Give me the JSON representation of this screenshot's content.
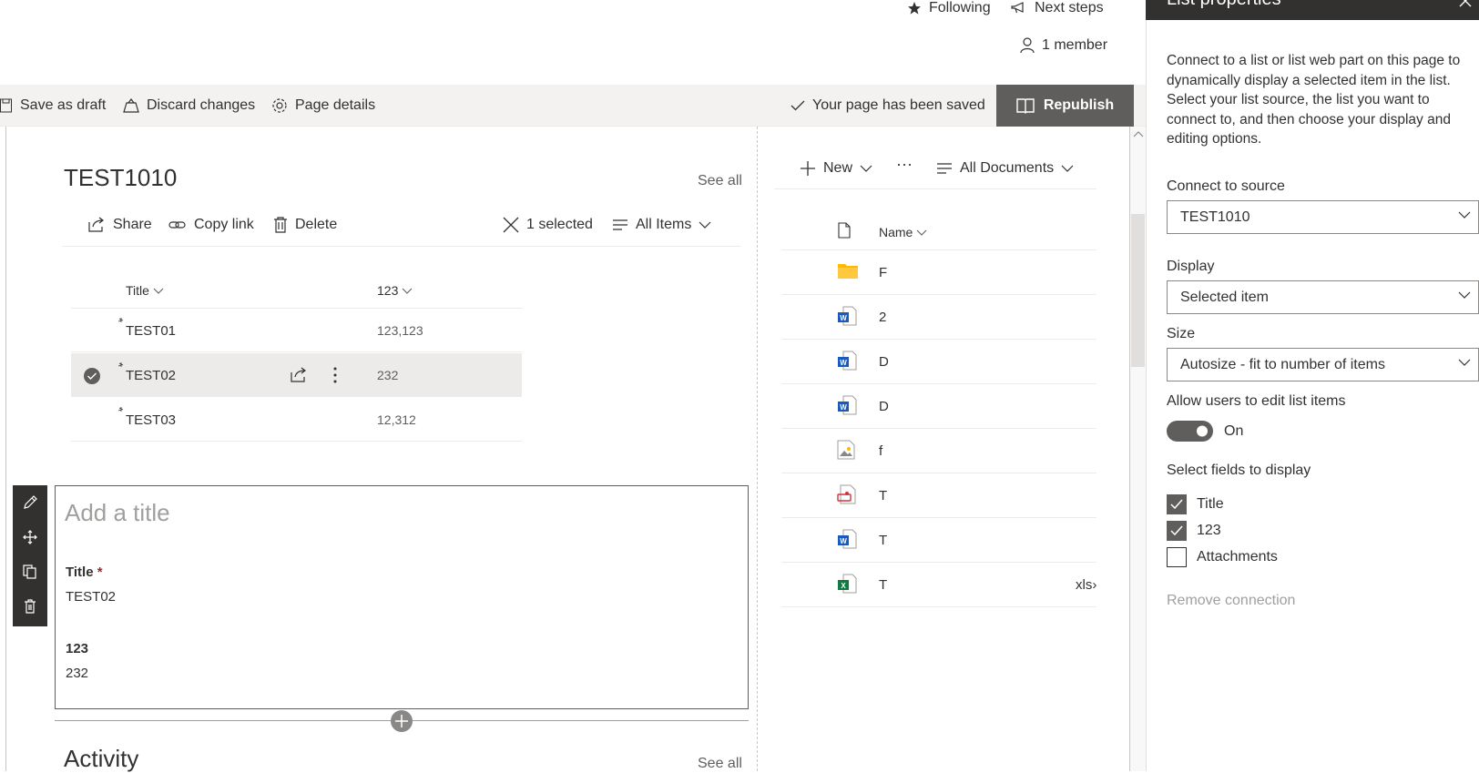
{
  "header": {
    "following_label": "Following",
    "next_steps_label": "Next steps",
    "members_label": "1 member"
  },
  "command_bar": {
    "save_draft_label": "Save as draft",
    "discard_label": "Discard changes",
    "page_details_label": "Page details",
    "saved_status": "Your page has been saved",
    "republish_label": "Republish"
  },
  "list_webpart": {
    "title": "TEST1010",
    "see_all": "See all",
    "share_label": "Share",
    "copy_link_label": "Copy link",
    "delete_label": "Delete",
    "selected_count": "1 selected",
    "view_label": "All Items",
    "columns": [
      "Title",
      "123"
    ],
    "rows": [
      {
        "title": "TEST01",
        "value": "123,123",
        "selected": false
      },
      {
        "title": "TEST02",
        "value": "232",
        "selected": true
      },
      {
        "title": "TEST03",
        "value": "12,312",
        "selected": false
      }
    ]
  },
  "form_webpart": {
    "title_placeholder": "Add a title",
    "field1_label": "Title",
    "field1_required": "*",
    "field1_value": "TEST02",
    "field2_label": "123",
    "field2_value": "232"
  },
  "activity": {
    "title": "Activity",
    "see_all": "See all"
  },
  "documents": {
    "new_label": "New",
    "more_label": "···",
    "view_label": "All Documents",
    "name_column": "Name",
    "rows": [
      {
        "icon": "folder-icon",
        "name": "F",
        "extra": ""
      },
      {
        "icon": "word-icon",
        "name": "2",
        "extra": ""
      },
      {
        "icon": "word-icon",
        "name": "D",
        "extra": ""
      },
      {
        "icon": "word-icon",
        "name": "D",
        "extra": ""
      },
      {
        "icon": "image-icon",
        "name": "f",
        "extra": ""
      },
      {
        "icon": "pdf-icon",
        "name": "T",
        "extra": ""
      },
      {
        "icon": "word-icon",
        "name": "T",
        "extra": ""
      },
      {
        "icon": "excel-icon",
        "name": "T",
        "extra": "xls›"
      }
    ]
  },
  "panel": {
    "title": "List properties",
    "description": "Connect to a list or list web part on this page to dynamically display a selected item in the list. Select your list source, the list you want to connect to, and then choose your display and editing options.",
    "source_label": "Connect to source",
    "source_value": "TEST1010",
    "display_label": "Display",
    "display_value": "Selected item",
    "size_label": "Size",
    "size_value": "Autosize - fit to number of items",
    "allow_edit_label": "Allow users to edit list items",
    "toggle_state": "On",
    "fields_label": "Select fields to display",
    "fields": [
      {
        "label": "Title",
        "checked": true
      },
      {
        "label": "123",
        "checked": true
      },
      {
        "label": "Attachments",
        "checked": false
      }
    ],
    "remove_label": "Remove connection"
  },
  "colors": {
    "dark": "#323130",
    "republish_bg": "#605e5c",
    "command_bg": "#f3f2f1",
    "word_blue": "#185abd",
    "excel_green": "#107c41",
    "folder_yellow": "#ffb900",
    "pdf_red": "#d13438"
  }
}
